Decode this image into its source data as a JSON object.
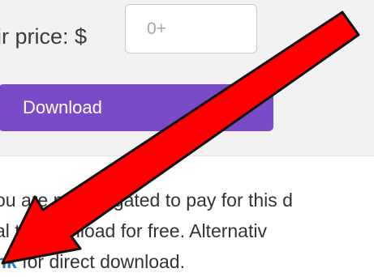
{
  "purchase": {
    "price_label": "ir price: $",
    "price_placeholder": "0+",
    "download_label": "Download"
  },
  "info": {
    "line1": "ou are not obligated to pay for this d",
    "line2": "al    to download for free. Alternativ",
    "line3_link": "nk",
    "line3_rest": " for direct download."
  },
  "colors": {
    "panel_bg": "#f2f2f2",
    "button_bg": "#7a4bc8",
    "link": "#2d78c6",
    "arrow_fill": "#ff0000"
  },
  "overlay": {
    "icon": "red-arrow-icon",
    "direction": "down-left"
  }
}
